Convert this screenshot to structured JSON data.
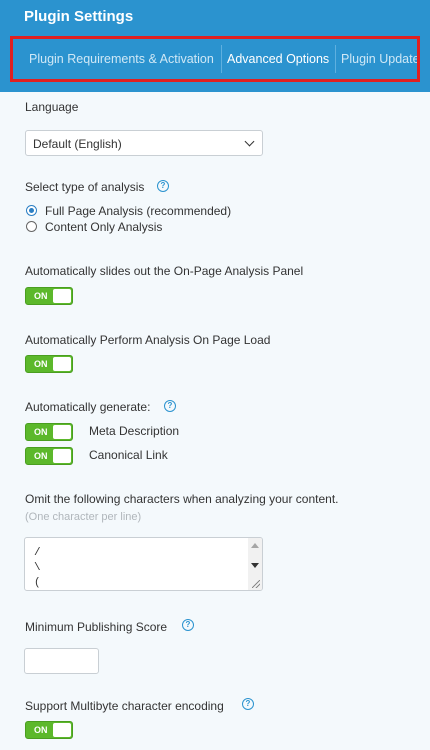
{
  "header": {
    "title": "Plugin Settings",
    "tabs": [
      {
        "label": "Plugin Requirements & Activation",
        "active": false
      },
      {
        "label": "Advanced Options",
        "active": true
      },
      {
        "label": "Plugin Update",
        "active": false
      }
    ]
  },
  "language": {
    "label": "Language",
    "selected": "Default (English)"
  },
  "analysis": {
    "label": "Select type of analysis",
    "help_icon": "question-circle-icon",
    "options": [
      {
        "label": "Full Page Analysis (recommended)",
        "checked": true
      },
      {
        "label": "Content Only Analysis",
        "checked": false
      }
    ]
  },
  "slide_panel": {
    "label": "Automatically slides out the On-Page Analysis Panel",
    "toggle": "ON"
  },
  "analysis_on_load": {
    "label": "Automatically Perform Analysis On Page Load",
    "toggle": "ON"
  },
  "auto_generate": {
    "label": "Automatically generate:",
    "help_icon": "question-circle-icon",
    "items": [
      {
        "label": "Meta Description",
        "toggle": "ON"
      },
      {
        "label": "Canonical Link",
        "toggle": "ON"
      }
    ]
  },
  "omit_chars": {
    "label": "Omit the following characters when analyzing your content.",
    "hint": "(One character per line)",
    "lines": [
      "/",
      "\\",
      "("
    ]
  },
  "min_score": {
    "label": "Minimum Publishing Score",
    "help_icon": "question-circle-icon",
    "value": ""
  },
  "multibyte": {
    "label": "Support Multibyte character encoding",
    "help_icon": "question-circle-icon",
    "toggle": "ON"
  },
  "colors": {
    "header_blue": "#2b93cf",
    "toggle_green": "#5cb82b",
    "highlight_red": "#e02020",
    "page_bg": "#f4f9fc"
  }
}
